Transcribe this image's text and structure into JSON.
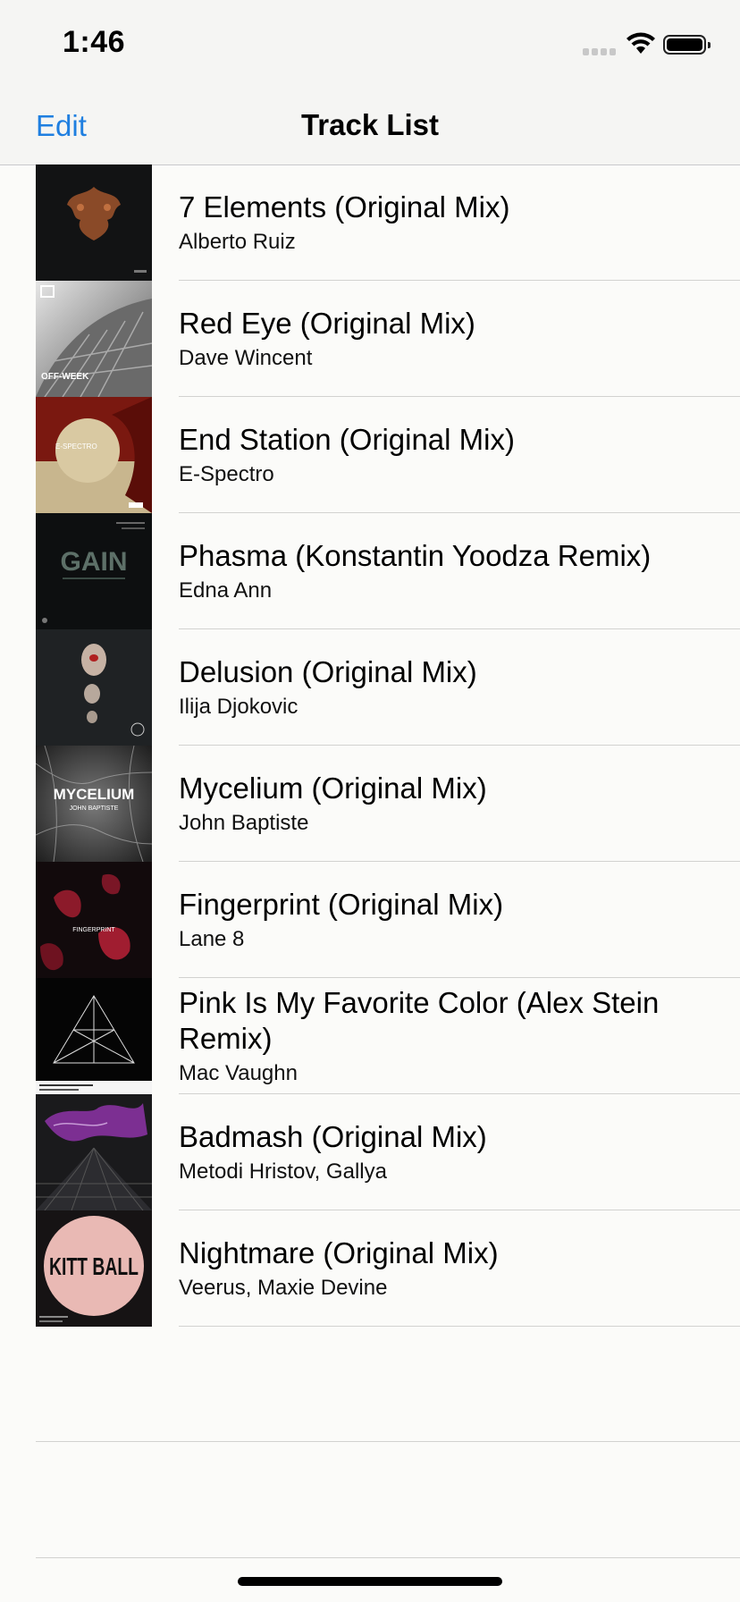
{
  "status": {
    "time": "1:46"
  },
  "nav": {
    "edit_label": "Edit",
    "title": "Track List"
  },
  "tracks": [
    {
      "title": "7 Elements (Original Mix)",
      "artist": "Alberto Ruiz"
    },
    {
      "title": "Red Eye (Original Mix)",
      "artist": "Dave Wincent"
    },
    {
      "title": "End Station (Original Mix)",
      "artist": "E-Spectro"
    },
    {
      "title": "Phasma (Konstantin Yoodza Remix)",
      "artist": "Edna Ann"
    },
    {
      "title": "Delusion (Original Mix)",
      "artist": "Ilija Djokovic"
    },
    {
      "title": "Mycelium (Original Mix)",
      "artist": "John Baptiste"
    },
    {
      "title": "Fingerprint (Original Mix)",
      "artist": "Lane 8"
    },
    {
      "title": "Pink Is My Favorite Color (Alex Stein Remix)",
      "artist": "Mac Vaughn"
    },
    {
      "title": "Badmash (Original Mix)",
      "artist": "Metodi Hristov, Gallya"
    },
    {
      "title": "Nightmare (Original Mix)",
      "artist": "Veerus, Maxie Devine"
    }
  ],
  "artwork": {
    "red_eye_logo": "OFF-WEEK",
    "end_station_logo": "E-SPECTRO",
    "phasma_logo": "GAIN",
    "mycelium_logo": "MYCELIUM",
    "mycelium_sub": "JOHN BAPTISTE",
    "fingerprint_logo": "FINGERPRINT",
    "nightmare_logo": "KITT BALL"
  },
  "colors": {
    "accent": "#1f7fe0",
    "background": "#fbfbf9",
    "bar": "#f5f5f3"
  }
}
